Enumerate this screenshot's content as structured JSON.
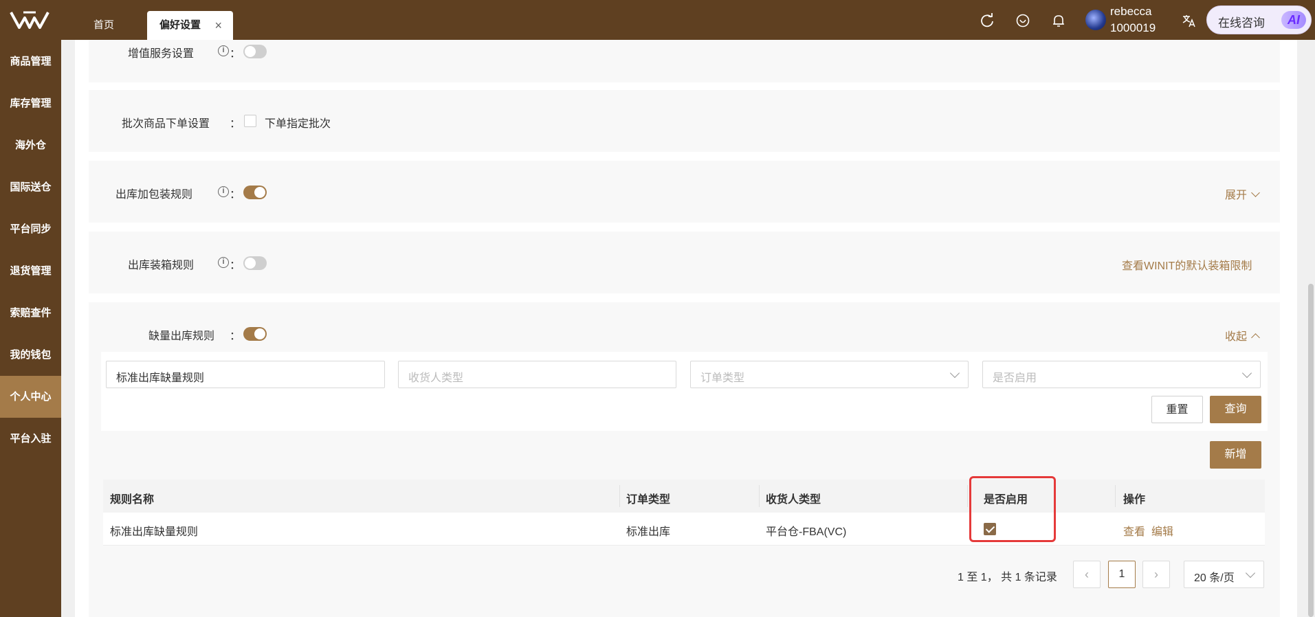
{
  "header": {
    "tabs": [
      {
        "label": "首页"
      },
      {
        "label": "偏好设置"
      }
    ],
    "close_glyph": "×",
    "user": {
      "name": "rebecca",
      "id": "1000019"
    },
    "ai_button": {
      "label": "在线咨询",
      "badge": "AI"
    },
    "icons": [
      "refresh-icon",
      "heart-icon",
      "bell-icon",
      "translate-icon"
    ]
  },
  "sidebar": {
    "items": [
      {
        "label": "商品管理"
      },
      {
        "label": "库存管理"
      },
      {
        "label": "海外仓"
      },
      {
        "label": "国际送仓"
      },
      {
        "label": "平台同步"
      },
      {
        "label": "退货管理"
      },
      {
        "label": "索赔查件"
      },
      {
        "label": "我的钱包"
      },
      {
        "label": "个人中心",
        "active": true
      },
      {
        "label": "平台入驻"
      }
    ]
  },
  "settings": {
    "value_added": {
      "label": "增值服务设置",
      "enabled": false
    },
    "batch": {
      "label": "批次商品下单设置",
      "checkbox_label": "下单指定批次",
      "checked": false
    },
    "packaging": {
      "label": "出库加包装规则",
      "enabled": true,
      "link": "展开"
    },
    "boxing": {
      "label": "出库装箱规则",
      "enabled": false,
      "link": "查看WINIT的默认装箱限制"
    },
    "shortage": {
      "label": "缺量出库规则",
      "enabled": true,
      "link": "收起"
    },
    "colon": "："
  },
  "filters": {
    "rule_name": {
      "value": "标准出库缺量规则"
    },
    "consignee_type": {
      "placeholder": "收货人类型"
    },
    "order_type": {
      "placeholder": "订单类型"
    },
    "enabled": {
      "placeholder": "是否启用"
    },
    "reset_label": "重置",
    "query_label": "查询",
    "add_label": "新增"
  },
  "table": {
    "headers": [
      "规则名称",
      "订单类型",
      "收货人类型",
      "是否启用",
      "操作"
    ],
    "rows": [
      {
        "name": "标准出库缺量规则",
        "order_type": "标准出库",
        "consignee_type": "平台仓-FBA(VC)",
        "enabled": true,
        "view": "查看",
        "edit": "编辑"
      }
    ]
  },
  "pagination": {
    "summary": "1 至 1， 共 1 条记录",
    "current": "1",
    "prev": "‹",
    "next": "›",
    "page_size": "20 条/页"
  },
  "colors": {
    "brand": "#5f4021",
    "accent": "#a47b49",
    "highlight": "#e53a3a"
  }
}
